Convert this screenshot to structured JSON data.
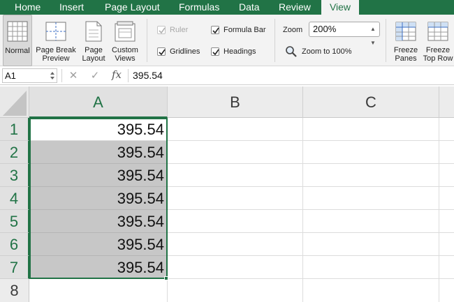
{
  "tabs": [
    "Home",
    "Insert",
    "Page Layout",
    "Formulas",
    "Data",
    "Review",
    "View"
  ],
  "active_tab": "View",
  "ribbon": {
    "views": {
      "normal": [
        "Normal"
      ],
      "page_break": [
        "Page Break",
        "Preview"
      ],
      "page_layout": [
        "Page",
        "Layout"
      ],
      "custom_views": [
        "Custom",
        "Views"
      ]
    },
    "show": {
      "ruler": "Ruler",
      "gridlines": "Gridlines",
      "formula_bar": "Formula Bar",
      "headings": "Headings"
    },
    "zoom": {
      "label": "Zoom",
      "value": "200%",
      "to_100": "Zoom to 100%"
    },
    "freeze": {
      "panes": [
        "Freeze",
        "Panes"
      ],
      "top_row": [
        "Freeze",
        "Top Row"
      ]
    }
  },
  "formula_bar": {
    "name_box": "A1",
    "fx": "fx",
    "cancel_icon": "✕",
    "enter_icon": "✓",
    "value": "395.54"
  },
  "sheet": {
    "columns": [
      "A",
      "B",
      "C"
    ],
    "rows": [
      "1",
      "2",
      "3",
      "4",
      "5",
      "6",
      "7",
      "8"
    ],
    "column_a_values": [
      "395.54",
      "395.54",
      "395.54",
      "395.54",
      "395.54",
      "395.54",
      "395.54",
      ""
    ],
    "selected_range": "A1:A7",
    "active_cell": "A1"
  },
  "colors": {
    "accent": "#217346",
    "ribbon_bg": "#f3f3f3",
    "selection_fill": "#c7c7c7"
  }
}
